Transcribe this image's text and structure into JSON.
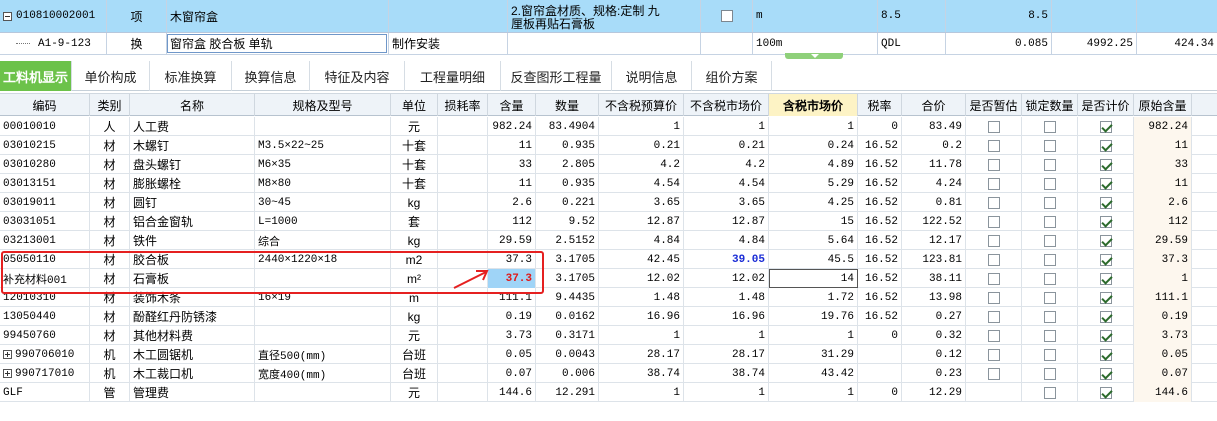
{
  "quota": {
    "row1": {
      "code": "010810002001",
      "type": "项",
      "name": "木窗帘盒",
      "feature_line1": "2.窗帘盒材质、规格:定制 九",
      "feature_line2": "厘板再贴石膏板",
      "unit": "m",
      "qty1": "8.5",
      "qty2": "8.5"
    },
    "row2": {
      "code": "A1-9-123",
      "type": "换",
      "name": "窗帘盒 胶合板 单轨",
      "content": "制作安装",
      "unit": "100m",
      "expr": "QDL",
      "qty": "0.085",
      "price": "4992.25",
      "total": "424.34"
    }
  },
  "tabs": [
    "工料机显示",
    "单价构成",
    "标准换算",
    "换算信息",
    "特征及内容",
    "工程量明细",
    "反查图形工程量",
    "说明信息",
    "组价方案"
  ],
  "columns": [
    "编码",
    "类别",
    "名称",
    "规格及型号",
    "单位",
    "损耗率",
    "含量",
    "数量",
    "不含税预算价",
    "不含税市场价",
    "含税市场价",
    "税率",
    "合价",
    "是否暂估",
    "锁定数量",
    "是否计价",
    "原始含量"
  ],
  "rows": [
    {
      "code": "00010010",
      "cat": "人",
      "name": "人工费",
      "spec": "",
      "unit": "元",
      "loss": "",
      "content": "982.24",
      "qty": "83.4904",
      "pre": "1",
      "mkt": "1",
      "taxmkt": "1",
      "rate": "0",
      "total": "83.49",
      "est": false,
      "lock": false,
      "price": true,
      "orig": "982.24"
    },
    {
      "code": "03010215",
      "cat": "材",
      "name": "木螺钉",
      "spec": "M3.5×22~25",
      "unit": "十套",
      "loss": "",
      "content": "11",
      "qty": "0.935",
      "pre": "0.21",
      "mkt": "0.21",
      "taxmkt": "0.24",
      "rate": "16.52",
      "total": "0.2",
      "est": false,
      "lock": false,
      "price": true,
      "orig": "11"
    },
    {
      "code": "03010280",
      "cat": "材",
      "name": "盘头螺钉",
      "spec": "M6×35",
      "unit": "十套",
      "loss": "",
      "content": "33",
      "qty": "2.805",
      "pre": "4.2",
      "mkt": "4.2",
      "taxmkt": "4.89",
      "rate": "16.52",
      "total": "11.78",
      "est": false,
      "lock": false,
      "price": true,
      "orig": "33"
    },
    {
      "code": "03013151",
      "cat": "材",
      "name": "膨胀螺栓",
      "spec": "M8×80",
      "unit": "十套",
      "loss": "",
      "content": "11",
      "qty": "0.935",
      "pre": "4.54",
      "mkt": "4.54",
      "taxmkt": "5.29",
      "rate": "16.52",
      "total": "4.24",
      "est": false,
      "lock": false,
      "price": true,
      "orig": "11"
    },
    {
      "code": "03019011",
      "cat": "材",
      "name": "圆钉",
      "spec": "30~45",
      "unit": "kg",
      "loss": "",
      "content": "2.6",
      "qty": "0.221",
      "pre": "3.65",
      "mkt": "3.65",
      "taxmkt": "4.25",
      "rate": "16.52",
      "total": "0.81",
      "est": false,
      "lock": false,
      "price": true,
      "orig": "2.6"
    },
    {
      "code": "03031051",
      "cat": "材",
      "name": "铝合金窗轨",
      "spec": "L=1000",
      "unit": "套",
      "loss": "",
      "content": "112",
      "qty": "9.52",
      "pre": "12.87",
      "mkt": "12.87",
      "taxmkt": "15",
      "rate": "16.52",
      "total": "122.52",
      "est": false,
      "lock": false,
      "price": true,
      "orig": "112"
    },
    {
      "code": "03213001",
      "cat": "材",
      "name": "铁件",
      "spec": "综合",
      "unit": "kg",
      "loss": "",
      "content": "29.59",
      "qty": "2.5152",
      "pre": "4.84",
      "mkt": "4.84",
      "taxmkt": "5.64",
      "rate": "16.52",
      "total": "12.17",
      "est": false,
      "lock": false,
      "price": true,
      "orig": "29.59"
    },
    {
      "code": "05050110",
      "cat": "材",
      "name": "胶合板",
      "spec": "2440×1220×18",
      "unit": "m2",
      "loss": "",
      "content": "37.3",
      "qty": "3.1705",
      "pre": "42.45",
      "mkt": "39.05",
      "taxmkt": "45.5",
      "rate": "16.52",
      "total": "123.81",
      "est": false,
      "lock": false,
      "price": true,
      "orig": "37.3"
    },
    {
      "code": "补充材料001",
      "cat": "材",
      "name": "石膏板",
      "spec": "",
      "unit": "m²",
      "loss": "",
      "content": "37.3",
      "qty": "3.1705",
      "pre": "12.02",
      "mkt": "12.02",
      "taxmkt": "14",
      "rate": "16.52",
      "total": "38.11",
      "est": false,
      "lock": false,
      "price": true,
      "orig": "1"
    },
    {
      "code": "12010310",
      "cat": "材",
      "name": "装饰木条",
      "spec": "16×19",
      "unit": "m",
      "loss": "",
      "content": "111.1",
      "qty": "9.4435",
      "pre": "1.48",
      "mkt": "1.48",
      "taxmkt": "1.72",
      "rate": "16.52",
      "total": "13.98",
      "est": false,
      "lock": false,
      "price": true,
      "orig": "111.1"
    },
    {
      "code": "13050440",
      "cat": "材",
      "name": "酚醛红丹防锈漆",
      "spec": "",
      "unit": "kg",
      "loss": "",
      "content": "0.19",
      "qty": "0.0162",
      "pre": "16.96",
      "mkt": "16.96",
      "taxmkt": "19.76",
      "rate": "16.52",
      "total": "0.27",
      "est": false,
      "lock": false,
      "price": true,
      "orig": "0.19"
    },
    {
      "code": "99450760",
      "cat": "材",
      "name": "其他材料费",
      "spec": "",
      "unit": "元",
      "loss": "",
      "content": "3.73",
      "qty": "0.3171",
      "pre": "1",
      "mkt": "1",
      "taxmkt": "1",
      "rate": "0",
      "total": "0.32",
      "est": false,
      "lock": false,
      "price": true,
      "orig": "3.73"
    },
    {
      "code": "990706010",
      "cat": "机",
      "name": "木工圆锯机",
      "spec": "直径500(mm)",
      "unit": "台班",
      "loss": "",
      "content": "0.05",
      "qty": "0.0043",
      "pre": "28.17",
      "mkt": "28.17",
      "taxmkt": "31.29",
      "rate": "",
      "total": "0.12",
      "est": false,
      "lock": false,
      "price": true,
      "orig": "0.05",
      "expand": true
    },
    {
      "code": "990717010",
      "cat": "机",
      "name": "木工裁口机",
      "spec": "宽度400(mm)",
      "unit": "台班",
      "loss": "",
      "content": "0.07",
      "qty": "0.006",
      "pre": "38.74",
      "mkt": "38.74",
      "taxmkt": "43.42",
      "rate": "",
      "total": "0.23",
      "est": false,
      "lock": false,
      "price": true,
      "orig": "0.07",
      "expand": true
    },
    {
      "code": "GLF",
      "cat": "管",
      "name": "管理费",
      "spec": "",
      "unit": "元",
      "loss": "",
      "content": "144.6",
      "qty": "12.291",
      "pre": "1",
      "mkt": "1",
      "taxmkt": "1",
      "rate": "0",
      "total": "12.29",
      "est": null,
      "lock": false,
      "price": true,
      "orig": "144.6"
    }
  ]
}
